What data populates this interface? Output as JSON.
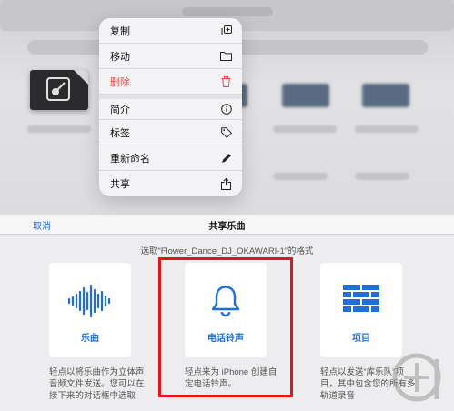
{
  "context_menu": {
    "items": [
      {
        "label": "复制",
        "icon": "duplicate-icon"
      },
      {
        "label": "移动",
        "icon": "folder-icon"
      },
      {
        "label": "删除",
        "icon": "trash-icon",
        "destructive": true
      },
      {
        "label": "简介",
        "icon": "info-icon"
      },
      {
        "label": "标签",
        "icon": "tag-icon"
      },
      {
        "label": "重新命名",
        "icon": "pencil-icon"
      },
      {
        "label": "共享",
        "icon": "share-icon"
      }
    ]
  },
  "share_sheet": {
    "cancel_label": "取消",
    "title": "共享乐曲",
    "subtitle": "选取“Flower_Dance_DJ_OKAWARI-1”的格式",
    "options": [
      {
        "label": "乐曲",
        "icon": "waveform-icon",
        "description": "轻点以将乐曲作为立体声音频文件发送。您可以在接下来的对话框中选取"
      },
      {
        "label": "电话铃声",
        "icon": "bell-icon",
        "description": "轻点来为 iPhone 创建自定电话铃声。"
      },
      {
        "label": "项目",
        "icon": "bricks-icon",
        "description": "轻点以发送“库乐队”项目，其中包含您的所有多轨道录音"
      }
    ]
  },
  "colors": {
    "accent": "#1f6fd6",
    "destructive": "#e64a3f",
    "highlight": "#e1161b"
  }
}
